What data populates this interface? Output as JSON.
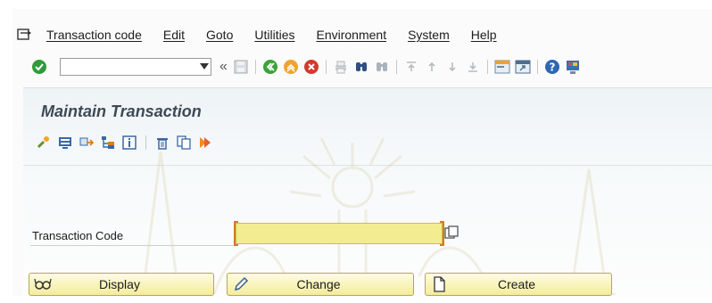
{
  "menu": {
    "items": [
      "Transaction code",
      "Edit",
      "Goto",
      "Utilities",
      "Environment",
      "System",
      "Help"
    ]
  },
  "toolbar": {
    "command_field_value": "",
    "icons": [
      "enter-icon",
      "save-icon",
      "back-icon",
      "exit-icon",
      "cancel-icon",
      "print-icon",
      "find-icon",
      "find-next-icon",
      "first-page-icon",
      "prev-page-icon",
      "next-page-icon",
      "last-page-icon",
      "create-session-icon",
      "shortcut-icon",
      "help-icon",
      "customize-layout-icon"
    ]
  },
  "screen": {
    "title": "Maintain Transaction"
  },
  "form": {
    "transaction_code_label": "Transaction Code",
    "transaction_code_value": ""
  },
  "buttons": {
    "display": "Display",
    "change": "Change",
    "create": "Create"
  },
  "colors": {
    "button_fill": "#f4ec9c",
    "input_fill": "#f3ec90",
    "title_text": "#3d4a56"
  }
}
